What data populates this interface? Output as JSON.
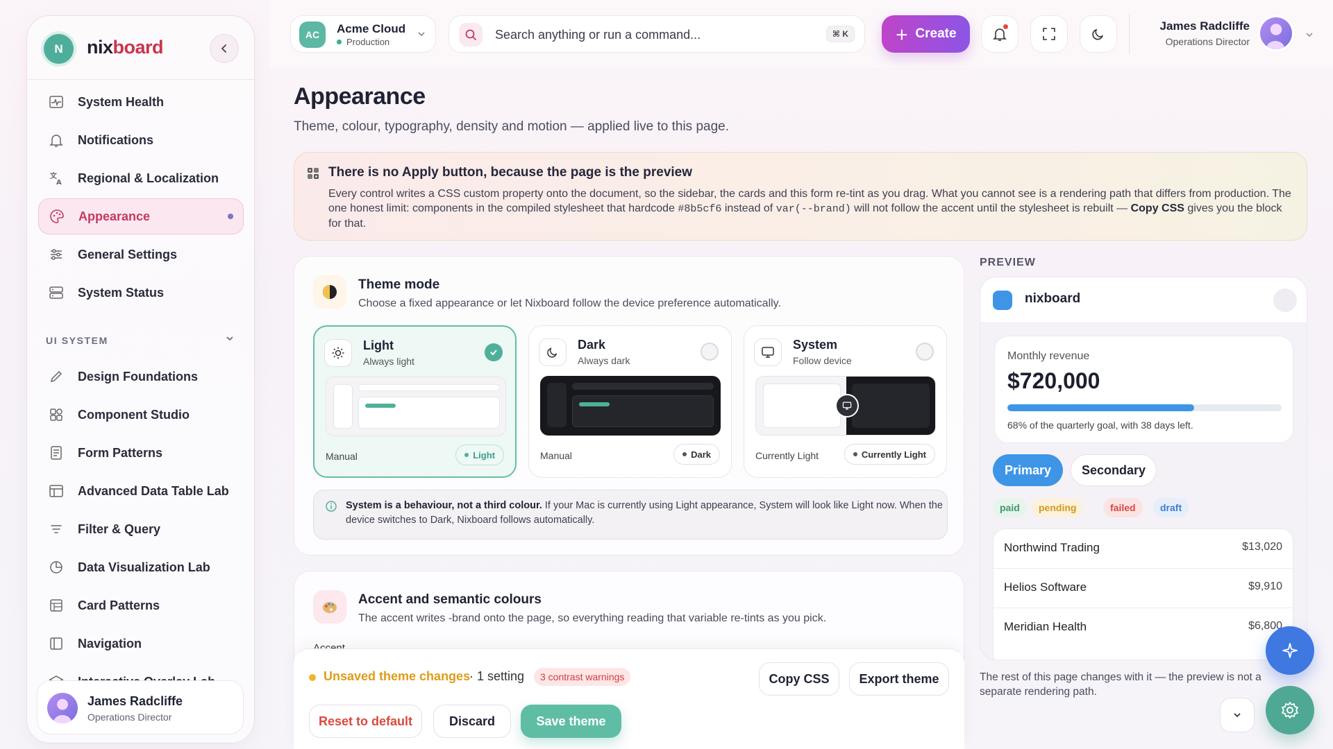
{
  "sidebar": {
    "brand_initial": "N",
    "brand_part1": "nix",
    "brand_part2": "board",
    "items_top": [
      {
        "label": "System Health",
        "icon": "pulse-icon"
      },
      {
        "label": "Notifications",
        "icon": "bell-icon"
      },
      {
        "label": "Regional & Localization",
        "icon": "translate-icon"
      },
      {
        "label": "Appearance",
        "icon": "palette-icon",
        "active": true
      },
      {
        "label": "General Settings",
        "icon": "sliders-icon"
      },
      {
        "label": "System Status",
        "icon": "server-icon"
      }
    ],
    "section_label": "UI SYSTEM",
    "items_ui": [
      {
        "label": "Design Foundations",
        "icon": "pen-icon"
      },
      {
        "label": "Component Studio",
        "icon": "grid-icon"
      },
      {
        "label": "Form Patterns",
        "icon": "form-icon"
      },
      {
        "label": "Advanced Data Table Lab",
        "icon": "table-icon"
      },
      {
        "label": "Filter & Query",
        "icon": "filter-icon"
      },
      {
        "label": "Data Visualization Lab",
        "icon": "pie-icon"
      },
      {
        "label": "Card Patterns",
        "icon": "cards-icon"
      },
      {
        "label": "Navigation",
        "icon": "sidebar-layout-icon"
      },
      {
        "label": "Interactive Overlay Lab",
        "icon": "layers-icon"
      }
    ],
    "user": {
      "name": "James Radcliffe",
      "role": "Operations Director"
    }
  },
  "topbar": {
    "env_initials": "AC",
    "env_name": "Acme Cloud",
    "env_stage": "Production",
    "search_placeholder": "Search anything or run a command...",
    "search_shortcut": "⌘ K",
    "create_label": "Create",
    "user_name": "James Radcliffe",
    "user_role": "Operations Director"
  },
  "page": {
    "title": "Appearance",
    "subtitle": "Theme, colour, typography, density and motion — applied live to this page."
  },
  "callout": {
    "title": "There is no Apply button, because the page is the preview",
    "body_1": "Every control writes a CSS custom property onto the document, so the sidebar, the cards and this form re-tint as you drag. What you cannot see is a rendering path that differs from production. The one honest limit: components in the compiled stylesheet that hardcode ",
    "code_1": "#8b5cf6",
    "body_2": " instead of ",
    "code_2": "var(--brand)",
    "body_3": " will not follow the accent until the stylesheet is rebuilt — ",
    "bold_1": "Copy CSS",
    "body_4": " gives you the block for that."
  },
  "theme_mode": {
    "title": "Theme mode",
    "subtitle": "Choose a fixed appearance or let Nixboard follow the device preference automatically.",
    "options": [
      {
        "name": "Light",
        "desc": "Always light",
        "foot": "Manual",
        "pill": "Light",
        "selected": true
      },
      {
        "name": "Dark",
        "desc": "Always dark",
        "foot": "Manual",
        "pill": "Dark",
        "selected": false
      },
      {
        "name": "System",
        "desc": "Follow device",
        "foot": "Currently Light",
        "pill": "Currently Light",
        "selected": false
      }
    ],
    "note_bold": "System is a behaviour, not a third colour.",
    "note_text": " If your Mac is currently using Light appearance, System will look like Light now. When the device switches to Dark, Nixboard follows automatically."
  },
  "accent": {
    "title": "Accent and semantic colours",
    "subtitle": "The accent writes -brand onto the page, so everything reading that variable re-tints as you pick.",
    "section": "Accent"
  },
  "bottombar": {
    "unsaved": "Unsaved theme changes",
    "settings": "· 1 setting",
    "warnings": "3 contrast warnings",
    "copy_css": "Copy CSS",
    "export": "Export theme",
    "reset": "Reset to default",
    "discard": "Discard",
    "save": "Save theme"
  },
  "preview": {
    "label": "PREVIEW",
    "brand": "nixboard",
    "revenue_label": "Monthly revenue",
    "revenue_value": "$720,000",
    "progress_fraction": 0.68,
    "revenue_caption": "68% of the quarterly goal, with 38 days left.",
    "primary": "Primary",
    "secondary": "Secondary",
    "tags": [
      "paid",
      "pending",
      "failed",
      "draft"
    ],
    "rows": [
      {
        "name": "Northwind Trading",
        "amount": "$13,020"
      },
      {
        "name": "Helios Software",
        "amount": "$9,910"
      },
      {
        "name": "Meridian Health",
        "amount": "$6,800"
      }
    ],
    "caption": "The rest of this page changes with it — the preview is not a separate rendering path."
  },
  "colors": {
    "brand_accent": "#c8344f",
    "success": "#4fb09a",
    "preview_primary": "#3e95e6",
    "warning": "#f0b52a",
    "danger": "#d33c3c"
  }
}
